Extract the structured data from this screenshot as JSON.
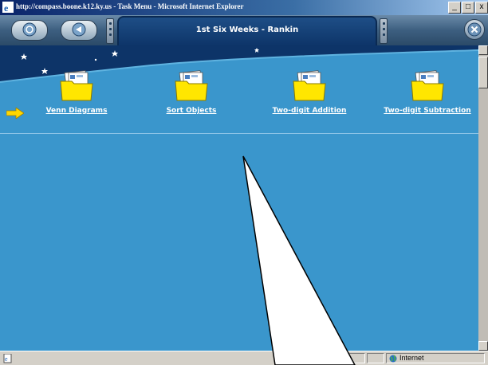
{
  "window": {
    "title": "http://compass.boone.k12.ky.us - Task Menu - Microsoft Internet Explorer",
    "minimize_glyph": "_",
    "maximize_glyph": "□",
    "close_glyph": "x"
  },
  "header": {
    "title": "1st Six Weeks - Rankin"
  },
  "tasks": [
    {
      "label": "Venn Diagrams",
      "icon": "folder-icon"
    },
    {
      "label": "Sort Objects",
      "icon": "folder-icon"
    },
    {
      "label": "Two-digit Addition",
      "icon": "folder-icon"
    },
    {
      "label": "Two-digit Subtraction",
      "icon": "folder-icon"
    }
  ],
  "statusbar": {
    "zone": "Internet"
  },
  "colors": {
    "content_bg": "#3a96cc",
    "header_panel": "#0d3468",
    "folder": "#ffe600",
    "indicator_arrow": "#ffd700"
  }
}
